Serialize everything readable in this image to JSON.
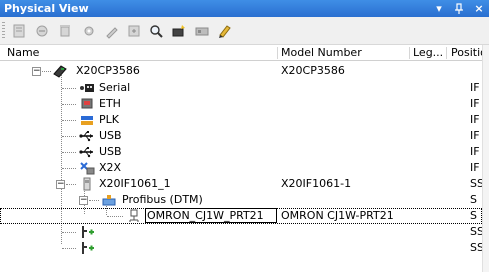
{
  "window": {
    "title": "Physical View",
    "dropdown_glyph": "▾",
    "pin_glyph": "ᚐ",
    "close_glyph": "×"
  },
  "toolbar": {
    "buttons": [
      {
        "name": "properties-icon"
      },
      {
        "name": "open-icon"
      },
      {
        "name": "delete-icon"
      },
      {
        "name": "configure-icon"
      },
      {
        "name": "wizard-icon"
      },
      {
        "name": "import-icon"
      },
      {
        "name": "find-icon"
      },
      {
        "name": "device-settings-icon"
      },
      {
        "name": "hardware-icon"
      },
      {
        "name": "edit-icon"
      }
    ]
  },
  "columns": {
    "name": "Name",
    "model": "Model Number",
    "legend": "Leg...",
    "position": "Positio"
  },
  "tree": {
    "rows": [
      {
        "label": "X20CP3586",
        "model": "X20CP3586",
        "pos": ""
      },
      {
        "label": "Serial",
        "model": "",
        "pos": "IF"
      },
      {
        "label": "ETH",
        "model": "",
        "pos": "IF"
      },
      {
        "label": "PLK",
        "model": "",
        "pos": "IF"
      },
      {
        "label": "USB",
        "model": "",
        "pos": "IF"
      },
      {
        "label": "USB",
        "model": "",
        "pos": "IF"
      },
      {
        "label": "X2X",
        "model": "",
        "pos": "IF"
      },
      {
        "label": "X20IF1061_1",
        "model": "X20IF1061-1",
        "pos": "SS"
      },
      {
        "label": "Profibus (DTM)",
        "model": "",
        "pos": "S"
      },
      {
        "label": "OMRON_CJ1W_PRT21",
        "model": "OMRON CJ1W-PRT21",
        "pos": "S"
      },
      {
        "label": "",
        "model": "",
        "pos": "SS"
      },
      {
        "label": "",
        "model": "",
        "pos": "SS"
      }
    ]
  },
  "colors": {
    "title_bg": "#2a6fd0",
    "plus_green": "#2f9e2f"
  }
}
